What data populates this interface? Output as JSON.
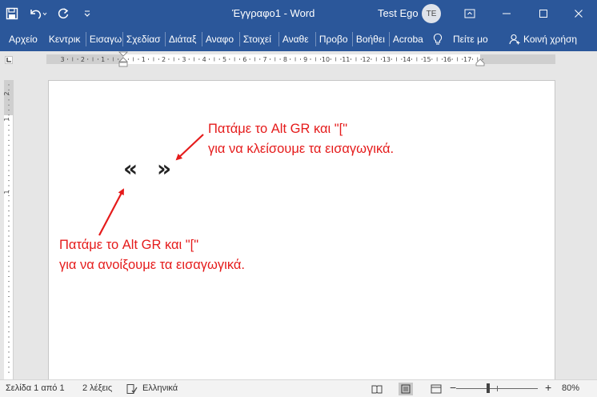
{
  "window": {
    "title": "Έγγραφο1 - Word",
    "user_name": "Test Ego",
    "user_initials": "TE"
  },
  "ribbon": {
    "file_tab": "Αρχείο",
    "tabs": [
      "Κεντρικ",
      "Εισαγω",
      "Σχεδίασ",
      "Διάταξ",
      "Αναφο",
      "Στοιχεί",
      "Αναθε",
      "Προβο",
      "Βοήθει",
      "Acroba"
    ],
    "tell_me": "Πείτε μο",
    "share": "Κοινή χρήση"
  },
  "ruler": {
    "left_numbers": [
      "3",
      "2",
      "1"
    ],
    "right_numbers": [
      "1",
      "2",
      "3",
      "4",
      "5",
      "6",
      "7",
      "8",
      "9",
      "10",
      "11",
      "12",
      "13",
      "14",
      "15",
      "16",
      "17"
    ],
    "vertical_numbers": [
      "2",
      "1",
      "1"
    ]
  },
  "document": {
    "open_quote": "«",
    "close_quote": "»",
    "annotation_top": [
      "Πατάμε το Alt GR και \"[\"",
      "για να κλείσουμε τα εισαγωγικά."
    ],
    "annotation_bottom": [
      "Πατάμε το Alt GR και \"[\"",
      "για να ανοίξουμε τα εισαγωγικά."
    ],
    "annotation_color": "#e51b1b"
  },
  "status": {
    "page_info": "Σελίδα 1 από 1",
    "word_count": "2 λέξεις",
    "language": "Ελληνικά",
    "zoom_minus": "−",
    "zoom_plus": "+",
    "zoom": "80%",
    "zoom_level": 80
  },
  "colors": {
    "brand": "#2b579a",
    "accent_red": "#e51b1b"
  }
}
